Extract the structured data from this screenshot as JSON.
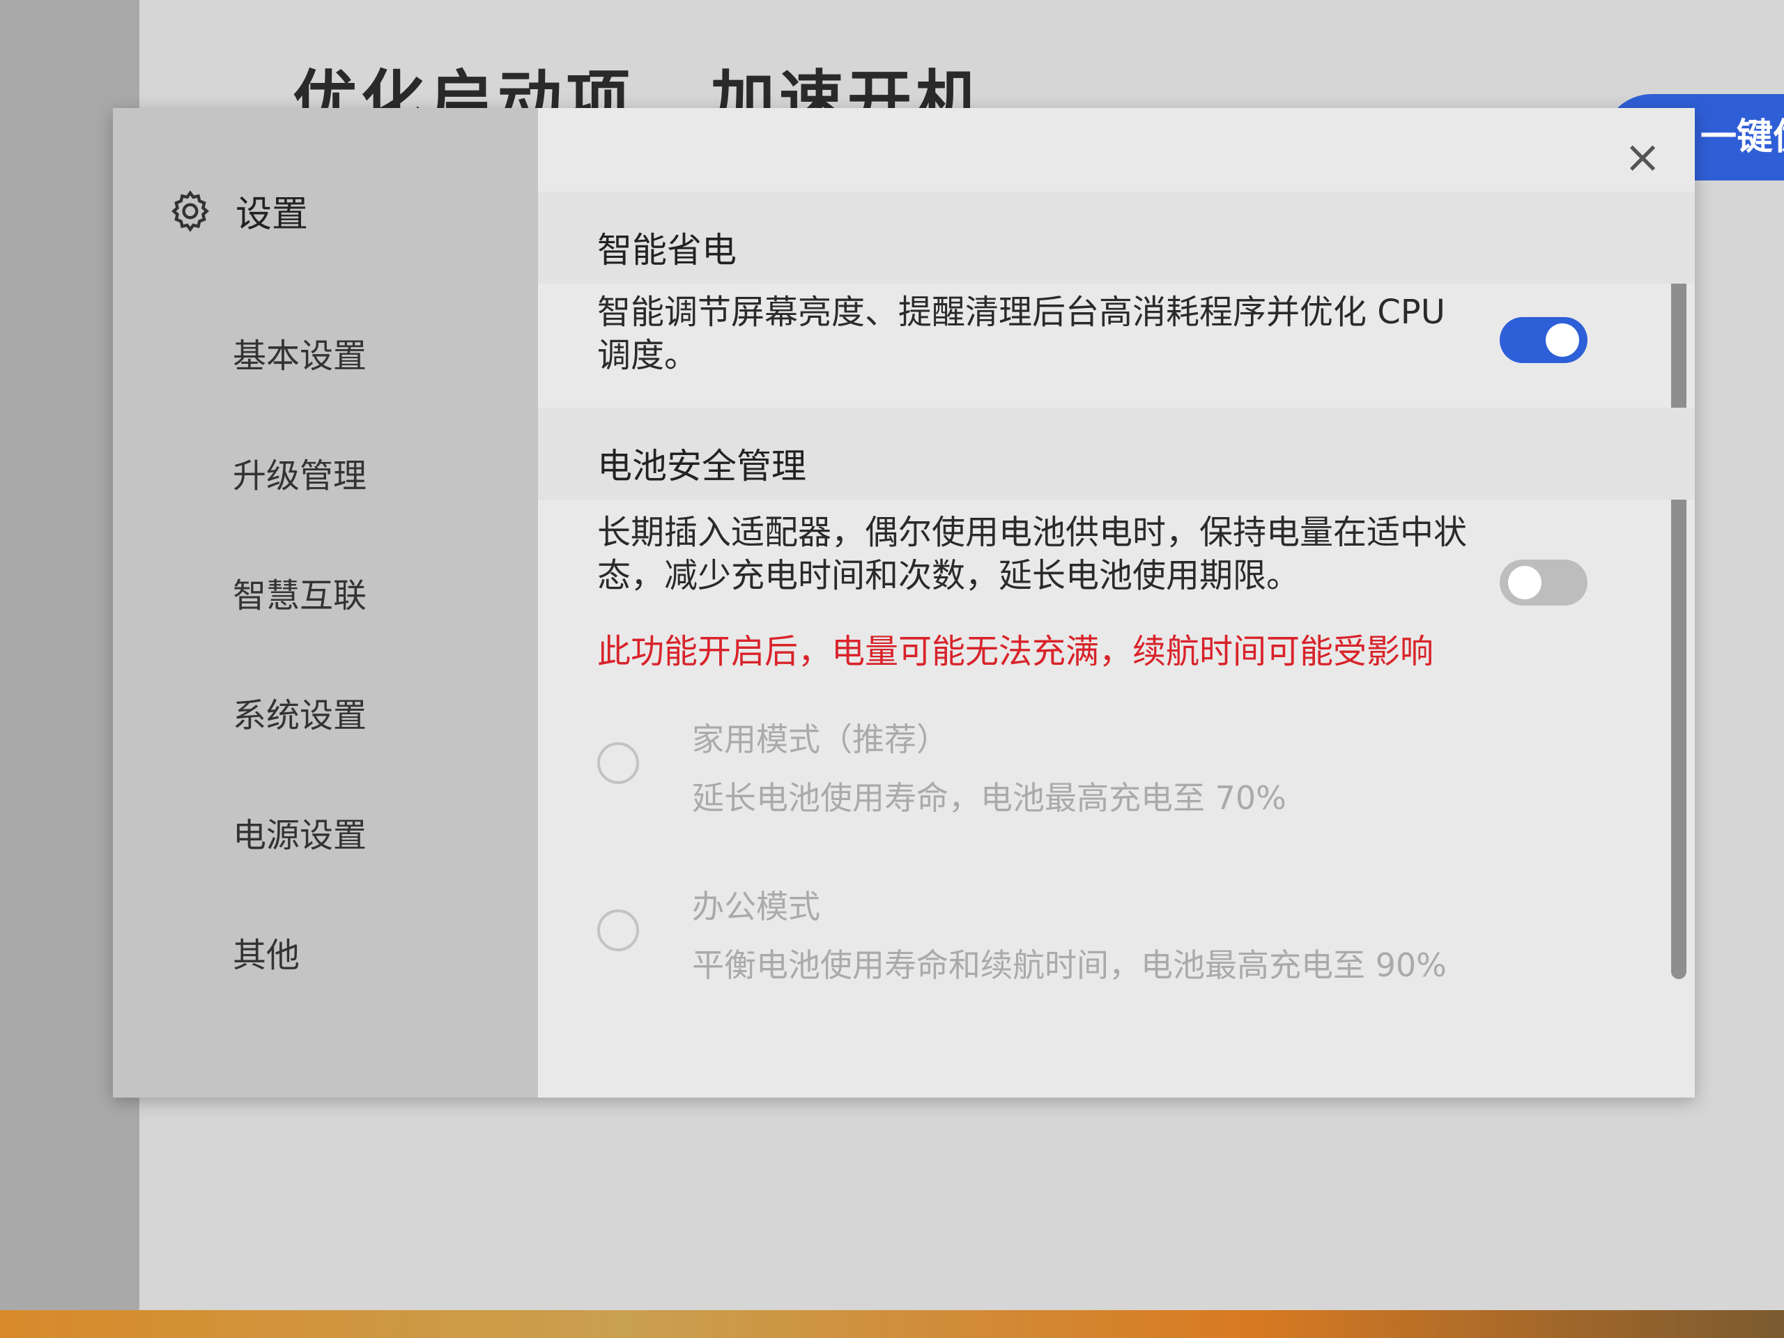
{
  "background": {
    "title_part1": "优化启动项",
    "title_part2": "加速开机",
    "pill_text": "一键优"
  },
  "dialog": {
    "title": "设置",
    "close_symbol": "×",
    "nav": [
      "基本设置",
      "升级管理",
      "智慧互联",
      "系统设置",
      "电源设置",
      "其他"
    ],
    "smart_power": {
      "title": "智能省电",
      "description": "智能调节屏幕亮度、提醒清理后台高消耗程序并优化 CPU 调度。",
      "enabled": true
    },
    "battery": {
      "title": "电池安全管理",
      "description": "长期插入适配器，偶尔使用电池供电时，保持电量在适中状态，减少充电时间和次数，延长电池使用期限。",
      "warning": "此功能开启后，电量可能无法充满，续航时间可能受影响",
      "enabled": false,
      "options": [
        {
          "title": "家用模式（推荐）",
          "description": "延长电池使用寿命，电池最高充电至 70%"
        },
        {
          "title": "办公模式",
          "description": "平衡电池使用寿命和续航时间，电池最高充电至 90%"
        }
      ]
    }
  },
  "colors": {
    "accent": "#2d5fd8",
    "warning": "#d8232a"
  }
}
